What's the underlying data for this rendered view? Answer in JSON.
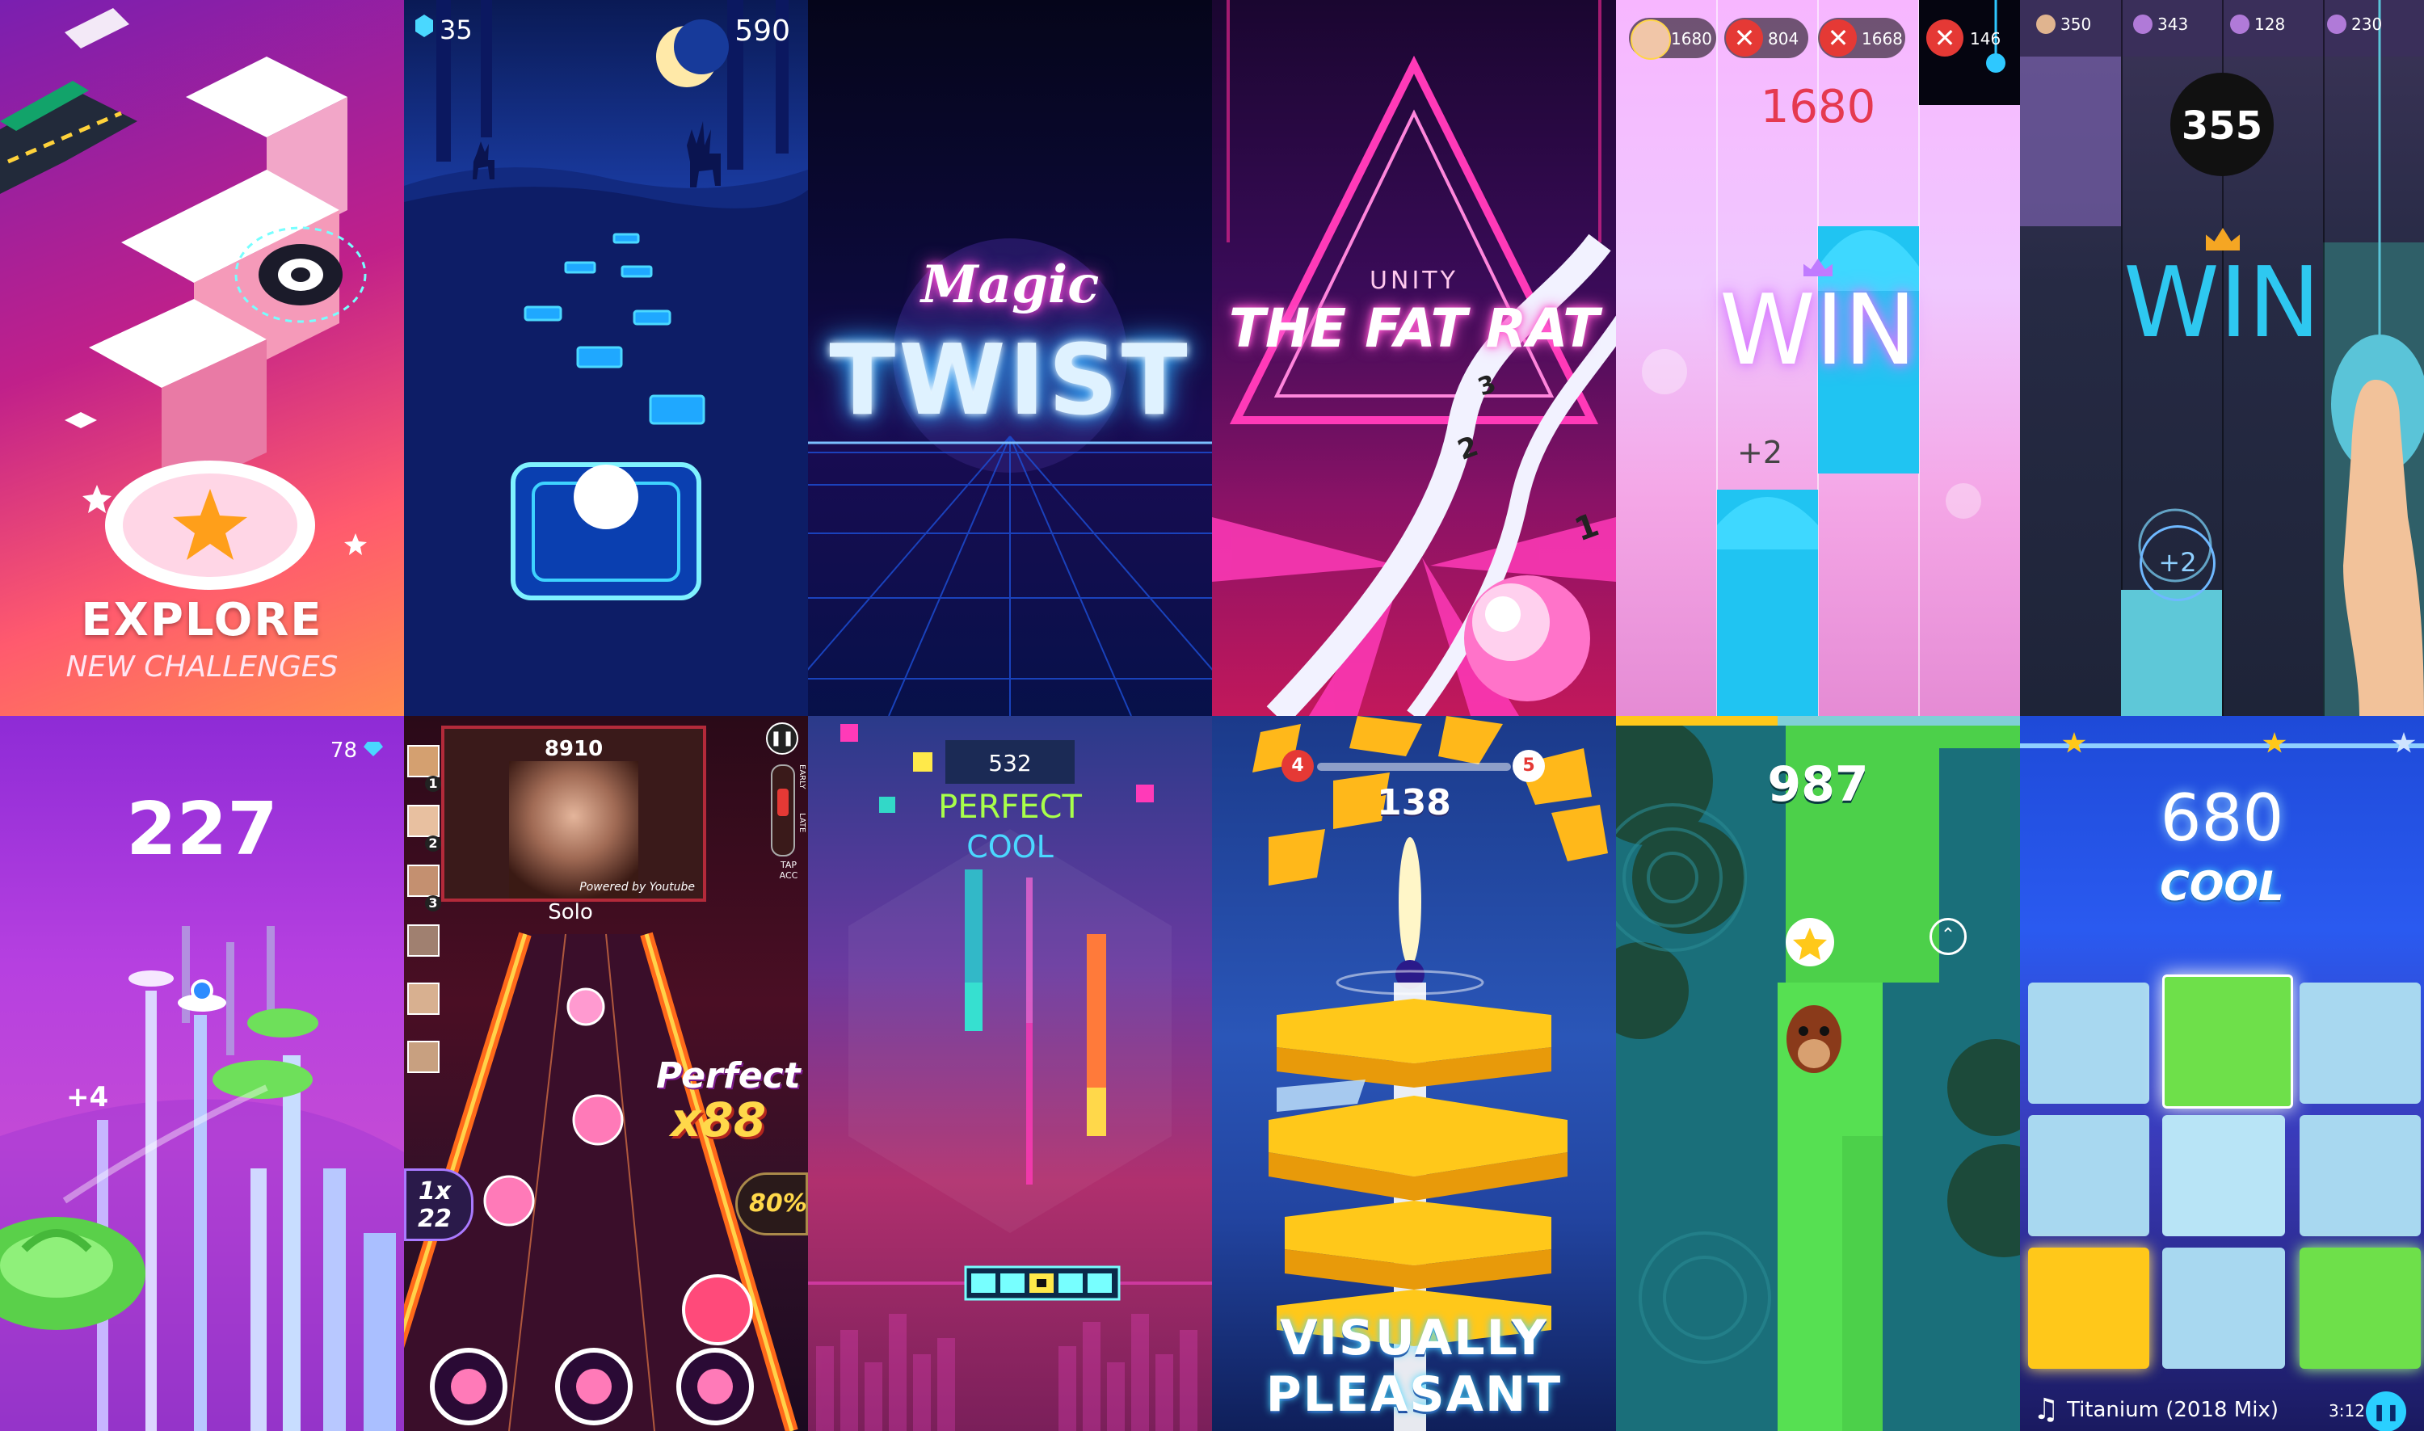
{
  "tiles": {
    "explore": {
      "line1": "EXPLORE",
      "line2": "NEW CHALLENGES"
    },
    "tiles_hop": {
      "gems": "35",
      "score": "590"
    },
    "magic_twist": {
      "small": "Magic",
      "big": "TWIST"
    },
    "fat_rat": {
      "small": "UNITY",
      "big": "THE FAT RAT",
      "marks": [
        "3",
        "2",
        "1"
      ]
    },
    "piano_pink": {
      "players": [
        {
          "score": "1680"
        },
        {
          "score": "804"
        },
        {
          "score": "1668"
        },
        {
          "score": "146"
        }
      ],
      "score": "1680",
      "win": "WIN",
      "bonus": "+2"
    },
    "piano_dark": {
      "players": [
        {
          "score": "350"
        },
        {
          "score": "343"
        },
        {
          "score": "128"
        },
        {
          "score": "230"
        }
      ],
      "score": "355",
      "win": "WIN",
      "bonus": "+2"
    },
    "candy_jump": {
      "gems": "78",
      "score": "227",
      "bonus": "+4"
    },
    "beat_fire": {
      "top_score": "8910",
      "solo": "Solo",
      "powered": "Powered by Youtube",
      "perfect": "Perfect",
      "combo": "x88",
      "mult": "1x",
      "mult_sub": "22",
      "pct": "80%",
      "ranks": [
        "1",
        "2",
        "3"
      ],
      "side_labels": [
        "EARLY",
        "LATE",
        "TAP ACC"
      ]
    },
    "bars": {
      "score": "532",
      "perfect": "PERFECT",
      "cool": "COOL"
    },
    "helix": {
      "left_level": "4",
      "score": "138",
      "right_level": "5",
      "line1": "VISUALLY",
      "line2": "PLEASANT"
    },
    "green_run": {
      "score": "987"
    },
    "beat_pads": {
      "score": "680",
      "grade": "COOL",
      "song": "Titanium (2018 Mix)",
      "time": "3:12"
    }
  }
}
